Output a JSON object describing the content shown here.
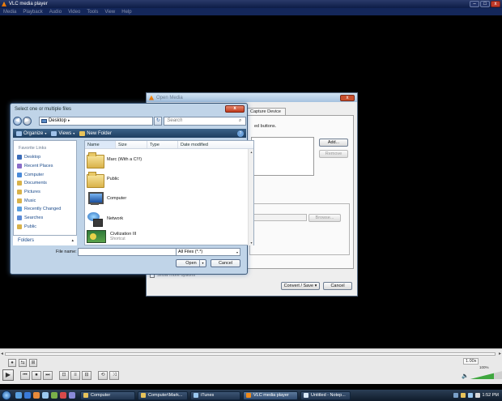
{
  "vlc": {
    "title": "VLC media player",
    "menu": [
      "Media",
      "Playback",
      "Audio",
      "Video",
      "Tools",
      "View",
      "Help"
    ],
    "window_buttons": {
      "minimize": "–",
      "maximize": "□",
      "close": "x"
    }
  },
  "open_media": {
    "title": "Open Media",
    "close": "x",
    "tabs": [
      "Capture Device"
    ],
    "hint": "ed buttons.",
    "add_label": "Add...",
    "remove_label": "Remove",
    "browse_label": "Browse...",
    "show_more_label": "Show more options",
    "convert_label": "Convert / Save",
    "convert_caret": "▾",
    "cancel_label": "Cancel"
  },
  "file_dialog": {
    "title": "Select one or multiple files",
    "close": "x",
    "nav_back": "◀",
    "nav_forward": "▶",
    "location": "Desktop",
    "location_arrow": "▸",
    "refresh": "↻",
    "search_placeholder": "Search",
    "search_icon": "⌕",
    "toolbar": {
      "organize": "Organize",
      "views": "Views",
      "new_folder": "New Folder",
      "caret": "▾",
      "help": "?"
    },
    "favorite_links_heading": "Favorite Links",
    "favorite_links": [
      "Desktop",
      "Recent Places",
      "Computer",
      "Documents",
      "Pictures",
      "Music",
      "Recently Changed",
      "Searches",
      "Public"
    ],
    "folders_label": "Folders",
    "folders_arrow": "▴",
    "columns": [
      "Name",
      "Size",
      "Type",
      "Date modified"
    ],
    "files": [
      {
        "name": "Marc (With a C!!!)",
        "icon": "folder-icon"
      },
      {
        "name": "Public",
        "icon": "folder-icon"
      },
      {
        "name": "Computer",
        "icon": "computer-icon"
      },
      {
        "name": "Network",
        "icon": "network-icon"
      },
      {
        "name": "Civilization III",
        "sub": "Shortcut",
        "icon": "game-icon"
      }
    ],
    "scroll_up": "▴",
    "scroll_down": "▾",
    "filename_label": "File name:",
    "filename_value": "",
    "filename_caret": "▾",
    "filter_value": "All Files (*.*)",
    "filter_caret": "▾",
    "open_label": "Open",
    "open_caret": "▾",
    "cancel_label": "Cancel"
  },
  "controls": {
    "seek_left": "◂",
    "seek_right": "▸",
    "row1": [
      "●",
      "⇆",
      "⊞"
    ],
    "play": "▶",
    "row2": [
      "⏮",
      "⏹",
      "⏭",
      "⊡",
      "≡",
      "⊟",
      "⟲",
      "⤨"
    ],
    "speed": "1.00x",
    "volume_icon": "🔈",
    "volume_text": "100%",
    "volume_level": 0.72
  },
  "taskbar": {
    "items": [
      {
        "label": "Computer",
        "color": "#e8c35a"
      },
      {
        "label": "Computer\\Mark...",
        "color": "#e8c35a"
      },
      {
        "label": "iTunes",
        "color": "#9ac8f0"
      },
      {
        "label": "VLC media player",
        "color": "#f08a1a",
        "active": true
      },
      {
        "label": "Untitled - Notep...",
        "color": "#d8e8f8"
      }
    ],
    "clock": "1:52 PM"
  },
  "colors": {
    "vlc_orange": "#f08a1a",
    "title_blue": "#0d1c46",
    "accent": "#5a8ad6"
  }
}
